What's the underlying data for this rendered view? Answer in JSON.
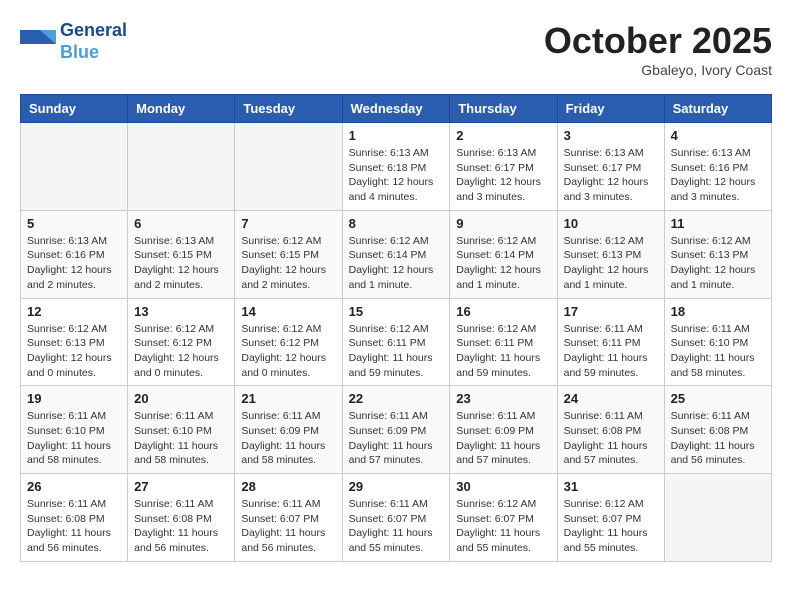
{
  "header": {
    "logo_line1": "General",
    "logo_line2": "Blue",
    "month": "October 2025",
    "location": "Gbaleyo, Ivory Coast"
  },
  "weekdays": [
    "Sunday",
    "Monday",
    "Tuesday",
    "Wednesday",
    "Thursday",
    "Friday",
    "Saturday"
  ],
  "weeks": [
    [
      {
        "day": "",
        "info": ""
      },
      {
        "day": "",
        "info": ""
      },
      {
        "day": "",
        "info": ""
      },
      {
        "day": "1",
        "info": "Sunrise: 6:13 AM\nSunset: 6:18 PM\nDaylight: 12 hours\nand 4 minutes."
      },
      {
        "day": "2",
        "info": "Sunrise: 6:13 AM\nSunset: 6:17 PM\nDaylight: 12 hours\nand 3 minutes."
      },
      {
        "day": "3",
        "info": "Sunrise: 6:13 AM\nSunset: 6:17 PM\nDaylight: 12 hours\nand 3 minutes."
      },
      {
        "day": "4",
        "info": "Sunrise: 6:13 AM\nSunset: 6:16 PM\nDaylight: 12 hours\nand 3 minutes."
      }
    ],
    [
      {
        "day": "5",
        "info": "Sunrise: 6:13 AM\nSunset: 6:16 PM\nDaylight: 12 hours\nand 2 minutes."
      },
      {
        "day": "6",
        "info": "Sunrise: 6:13 AM\nSunset: 6:15 PM\nDaylight: 12 hours\nand 2 minutes."
      },
      {
        "day": "7",
        "info": "Sunrise: 6:12 AM\nSunset: 6:15 PM\nDaylight: 12 hours\nand 2 minutes."
      },
      {
        "day": "8",
        "info": "Sunrise: 6:12 AM\nSunset: 6:14 PM\nDaylight: 12 hours\nand 1 minute."
      },
      {
        "day": "9",
        "info": "Sunrise: 6:12 AM\nSunset: 6:14 PM\nDaylight: 12 hours\nand 1 minute."
      },
      {
        "day": "10",
        "info": "Sunrise: 6:12 AM\nSunset: 6:13 PM\nDaylight: 12 hours\nand 1 minute."
      },
      {
        "day": "11",
        "info": "Sunrise: 6:12 AM\nSunset: 6:13 PM\nDaylight: 12 hours\nand 1 minute."
      }
    ],
    [
      {
        "day": "12",
        "info": "Sunrise: 6:12 AM\nSunset: 6:13 PM\nDaylight: 12 hours\nand 0 minutes."
      },
      {
        "day": "13",
        "info": "Sunrise: 6:12 AM\nSunset: 6:12 PM\nDaylight: 12 hours\nand 0 minutes."
      },
      {
        "day": "14",
        "info": "Sunrise: 6:12 AM\nSunset: 6:12 PM\nDaylight: 12 hours\nand 0 minutes."
      },
      {
        "day": "15",
        "info": "Sunrise: 6:12 AM\nSunset: 6:11 PM\nDaylight: 11 hours\nand 59 minutes."
      },
      {
        "day": "16",
        "info": "Sunrise: 6:12 AM\nSunset: 6:11 PM\nDaylight: 11 hours\nand 59 minutes."
      },
      {
        "day": "17",
        "info": "Sunrise: 6:11 AM\nSunset: 6:11 PM\nDaylight: 11 hours\nand 59 minutes."
      },
      {
        "day": "18",
        "info": "Sunrise: 6:11 AM\nSunset: 6:10 PM\nDaylight: 11 hours\nand 58 minutes."
      }
    ],
    [
      {
        "day": "19",
        "info": "Sunrise: 6:11 AM\nSunset: 6:10 PM\nDaylight: 11 hours\nand 58 minutes."
      },
      {
        "day": "20",
        "info": "Sunrise: 6:11 AM\nSunset: 6:10 PM\nDaylight: 11 hours\nand 58 minutes."
      },
      {
        "day": "21",
        "info": "Sunrise: 6:11 AM\nSunset: 6:09 PM\nDaylight: 11 hours\nand 58 minutes."
      },
      {
        "day": "22",
        "info": "Sunrise: 6:11 AM\nSunset: 6:09 PM\nDaylight: 11 hours\nand 57 minutes."
      },
      {
        "day": "23",
        "info": "Sunrise: 6:11 AM\nSunset: 6:09 PM\nDaylight: 11 hours\nand 57 minutes."
      },
      {
        "day": "24",
        "info": "Sunrise: 6:11 AM\nSunset: 6:08 PM\nDaylight: 11 hours\nand 57 minutes."
      },
      {
        "day": "25",
        "info": "Sunrise: 6:11 AM\nSunset: 6:08 PM\nDaylight: 11 hours\nand 56 minutes."
      }
    ],
    [
      {
        "day": "26",
        "info": "Sunrise: 6:11 AM\nSunset: 6:08 PM\nDaylight: 11 hours\nand 56 minutes."
      },
      {
        "day": "27",
        "info": "Sunrise: 6:11 AM\nSunset: 6:08 PM\nDaylight: 11 hours\nand 56 minutes."
      },
      {
        "day": "28",
        "info": "Sunrise: 6:11 AM\nSunset: 6:07 PM\nDaylight: 11 hours\nand 56 minutes."
      },
      {
        "day": "29",
        "info": "Sunrise: 6:11 AM\nSunset: 6:07 PM\nDaylight: 11 hours\nand 55 minutes."
      },
      {
        "day": "30",
        "info": "Sunrise: 6:12 AM\nSunset: 6:07 PM\nDaylight: 11 hours\nand 55 minutes."
      },
      {
        "day": "31",
        "info": "Sunrise: 6:12 AM\nSunset: 6:07 PM\nDaylight: 11 hours\nand 55 minutes."
      },
      {
        "day": "",
        "info": ""
      }
    ]
  ]
}
